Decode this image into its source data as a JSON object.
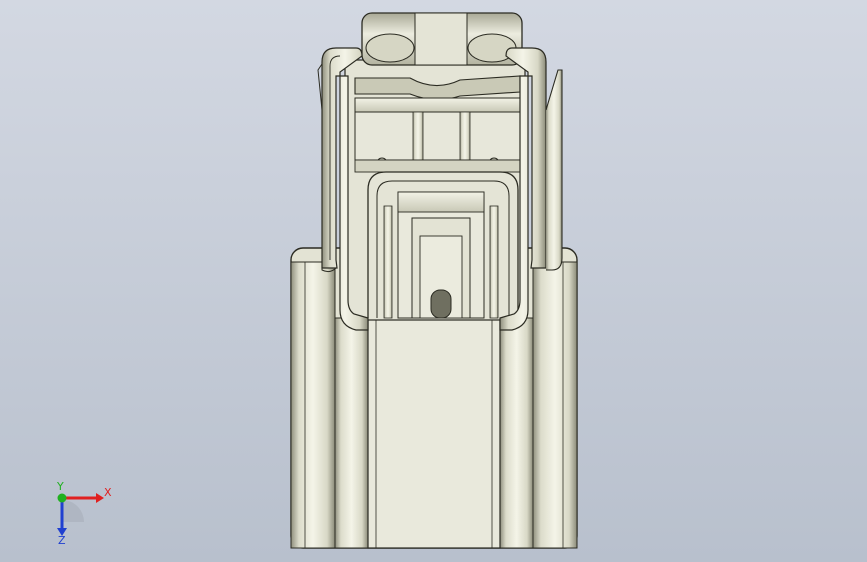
{
  "view": {
    "background_top": "#d3d8e2",
    "background_bottom": "#b8c0cd",
    "part_fill": "#e6e6d8",
    "part_shade": "#b9b9a6",
    "edge_color": "#2b2b22"
  },
  "triad": {
    "x_label": "X",
    "y_label": "Y",
    "z_label": "Z",
    "x_color": "#e02020",
    "y_color": "#20b020",
    "z_color": "#2040d0"
  }
}
